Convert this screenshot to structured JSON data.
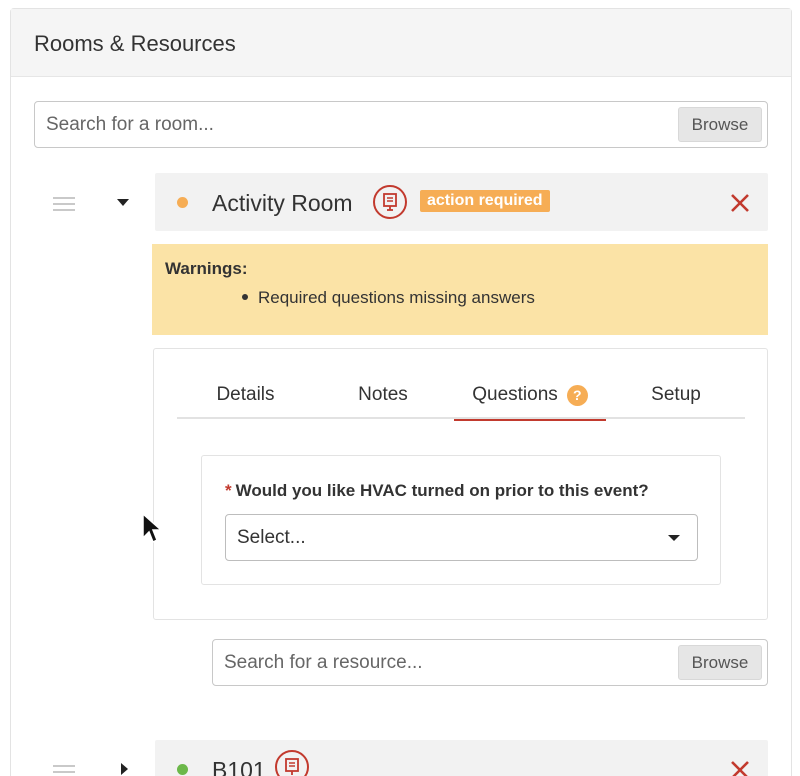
{
  "panel": {
    "title": "Rooms & Resources"
  },
  "room_search": {
    "placeholder": "Search for a room...",
    "browse_label": "Browse"
  },
  "rooms": [
    {
      "name": "Activity Room",
      "status_color": "#f6ad55",
      "badge": "action required",
      "icon": "presentation-board-icon",
      "remove_icon": "close-icon",
      "expanded": true
    },
    {
      "name": "B101",
      "status_color": "#6cb84a",
      "icon": "presentation-board-icon",
      "remove_icon": "close-icon",
      "expanded": false
    }
  ],
  "warnings": {
    "title": "Warnings:",
    "items": [
      "Required questions missing answers"
    ]
  },
  "tabs": [
    {
      "label": "Details",
      "active": false
    },
    {
      "label": "Notes",
      "active": false
    },
    {
      "label": "Questions",
      "active": true,
      "icon": "question-mark-icon",
      "icon_text": "?"
    },
    {
      "label": "Setup",
      "active": false
    }
  ],
  "question": {
    "required_mark": "*",
    "label": "Would you like HVAC turned on prior to this event?",
    "select_value": "Select..."
  },
  "resource_search": {
    "placeholder": "Search for a resource...",
    "browse_label": "Browse"
  },
  "colors": {
    "accent_red": "#c23a2e",
    "warning_bg": "#fbe3a6",
    "badge_orange": "#f6ad55"
  }
}
